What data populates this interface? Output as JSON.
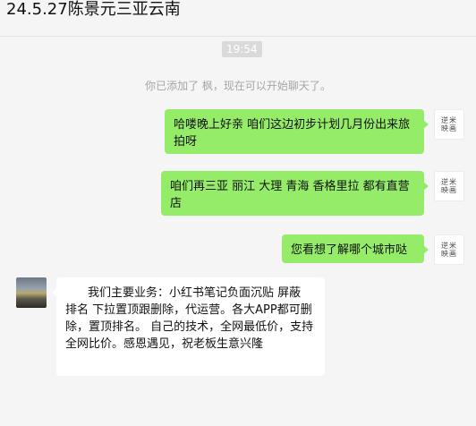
{
  "header": {
    "title": "24.5.27陈景元三亚云南"
  },
  "timestamp": "19:54",
  "system_message": "你已添加了   枫，现在可以开始聊天了。",
  "avatars": {
    "self_logo_line1": "逆米",
    "self_logo_line2": "映画"
  },
  "messages": [
    {
      "side": "right",
      "text": "哈喽晚上好亲 咱们这边初步计划几月份出来旅拍呀"
    },
    {
      "side": "right",
      "text": "咱们再三亚 丽江  大理 青海 香格里拉 都有直营店"
    },
    {
      "side": "right",
      "text": "您看想了解哪个城市哒"
    },
    {
      "side": "left",
      "text": "我们主要业务：小红书笔记负面沉贴 屏蔽 排名 下拉置顶跟删除，代运营。各大APP都可删除，置顶排名。 自己的技术，全网最低价，支持全网比价。感恩遇见，祝老板生意兴隆"
    }
  ],
  "colors": {
    "outgoing_bubble": "#95ec69",
    "incoming_bubble": "#ffffff",
    "background": "#f5f5f5"
  }
}
